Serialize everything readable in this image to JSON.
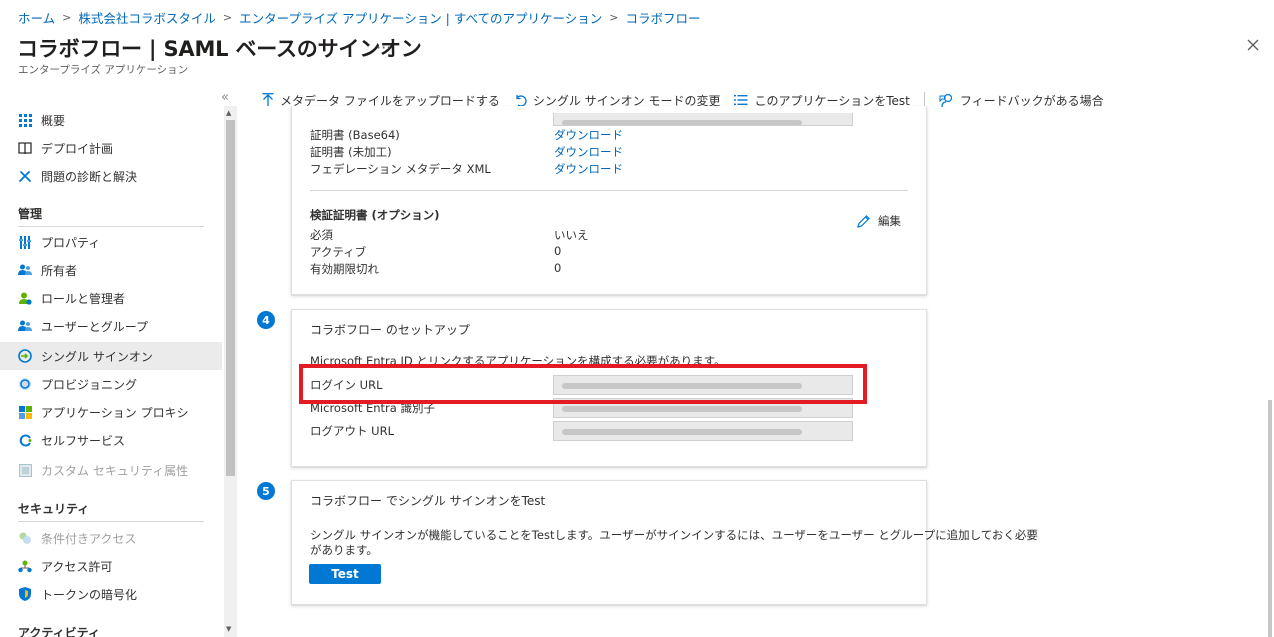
{
  "breadcrumb": [
    "ホーム",
    "株式会社コラボスタイル",
    "エンタープライズ アプリケーション | すべてのアプリケーション",
    "コラボフロー"
  ],
  "header": {
    "title": "コラボフロー | SAML ベースのサインオン",
    "more": "···",
    "subtitle": "エンタープライズ アプリケーション",
    "collapse": "«"
  },
  "sidebar": {
    "items_top": [
      {
        "label": "概要",
        "icon": "grid-icon"
      },
      {
        "label": "デプロイ計画",
        "icon": "book-icon"
      },
      {
        "label": "問題の診断と解決",
        "icon": "tools-icon"
      }
    ],
    "section_manage": "管理",
    "items_manage": [
      {
        "label": "プロパティ",
        "icon": "properties-icon"
      },
      {
        "label": "所有者",
        "icon": "owners-icon"
      },
      {
        "label": "ロールと管理者",
        "icon": "roles-icon"
      },
      {
        "label": "ユーザーとグループ",
        "icon": "users-groups-icon"
      },
      {
        "label": "シングル サインオン",
        "icon": "sso-icon"
      },
      {
        "label": "プロビジョニング",
        "icon": "provisioning-icon"
      },
      {
        "label": "アプリケーション プロキシ",
        "icon": "app-proxy-icon"
      },
      {
        "label": "セルフサービス",
        "icon": "self-service-icon"
      },
      {
        "label": "カスタム セキュリティ属性",
        "icon": "custom-security-icon"
      }
    ],
    "section_security": "セキュリティ",
    "items_security": [
      {
        "label": "条件付きアクセス",
        "icon": "conditional-access-icon"
      },
      {
        "label": "アクセス許可",
        "icon": "permissions-icon"
      },
      {
        "label": "トークンの暗号化",
        "icon": "shield-icon"
      }
    ],
    "section_activity": "アクティビティ"
  },
  "toolbar": {
    "upload": "メタデータ ファイルをアップロードする",
    "change_mode": "シングル サインオン モードの変更",
    "test_app": "このアプリケーションをTest",
    "feedback": "フィードバックがある場合"
  },
  "cert_section": {
    "rows": [
      {
        "label": "証明書 (Base64)",
        "link": "ダウンロード"
      },
      {
        "label": "証明書 (未加工)",
        "link": "ダウンロード"
      },
      {
        "label": "フェデレーション メタデータ XML",
        "link": "ダウンロード"
      }
    ],
    "verify_title": "検証証明書 (オプション)",
    "edit_label": "編集",
    "verify_rows": [
      {
        "label": "必須",
        "value": "いいえ"
      },
      {
        "label": "アクティブ",
        "value": "0"
      },
      {
        "label": "有効期限切れ",
        "value": "0"
      }
    ]
  },
  "step4": {
    "number": "4",
    "title": "コラボフロー のセットアップ",
    "description": "Microsoft Entra ID とリンクするアプリケーションを構成する必要があります。",
    "fields": [
      {
        "label": "ログイン URL"
      },
      {
        "label": "Microsoft Entra 識別子"
      },
      {
        "label": "ログアウト URL"
      }
    ]
  },
  "step5": {
    "number": "5",
    "title": "コラボフロー でシングル サインオンをTest",
    "description_line1": "シングル サインオンが機能していることをTestします。ユーザーがサインインするには、ユーザーをユーザー とグループに追加しておく必要",
    "description_line2": "があります。",
    "test_button": "Test"
  },
  "colors": {
    "accent": "#0078d4",
    "link": "#0067b8",
    "highlight": "#e31b23"
  }
}
